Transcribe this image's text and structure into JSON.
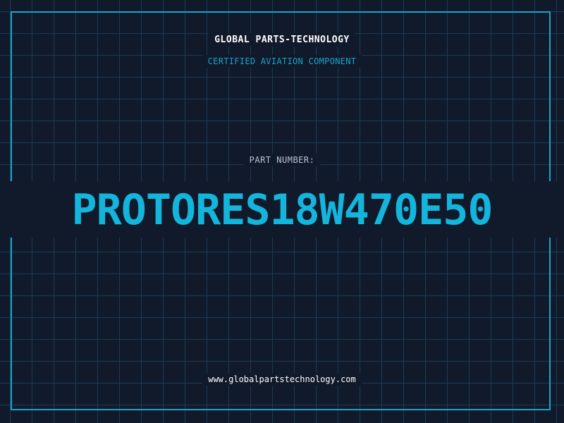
{
  "header": {
    "company": "GLOBAL PARTS-TECHNOLOGY",
    "subtitle": "CERTIFIED AVIATION COMPONENT"
  },
  "part": {
    "label": "PART NUMBER:",
    "number": "PROTORES18W470E50"
  },
  "footer": {
    "website": "www.globalpartstechnology.com"
  },
  "colors": {
    "background": "#111a2b",
    "grid": "#1d3a55",
    "accent": "#14b5dc",
    "text": "#ffffff"
  }
}
